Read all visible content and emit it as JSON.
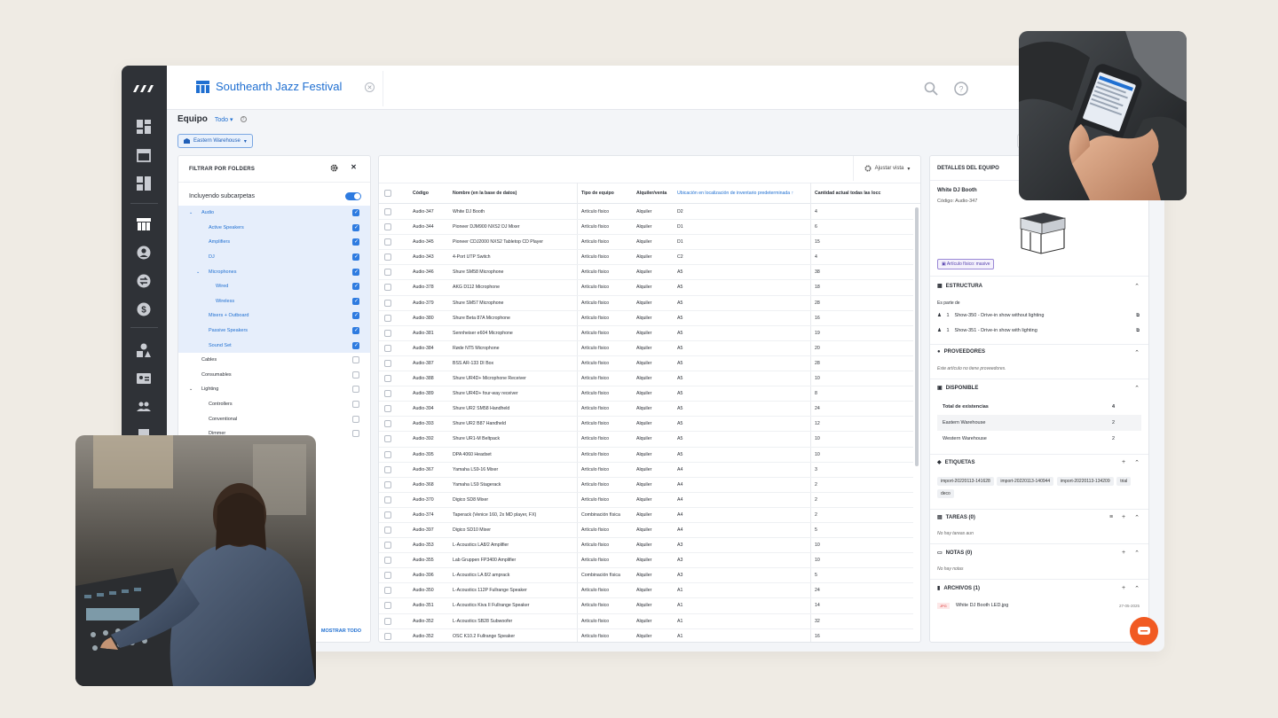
{
  "project": {
    "title": "Southearth Jazz Festival"
  },
  "notifications": {
    "count": "1"
  },
  "page": {
    "title": "Equipo",
    "scope": "Todo",
    "warehouse": "Eastern Warehouse"
  },
  "filter": {
    "title": "FILTRAR POR FOLDERS",
    "include_sub": "Incluyendo subcarpetas",
    "items": [
      {
        "label": "Audio",
        "checked": true
      },
      {
        "label": "Active Speakers",
        "checked": true
      },
      {
        "label": "Amplifiers",
        "checked": true
      },
      {
        "label": "DJ",
        "checked": true
      },
      {
        "label": "Microphones",
        "checked": true
      },
      {
        "label": "Wired",
        "checked": true
      },
      {
        "label": "Wireless",
        "checked": true
      },
      {
        "label": "Mixers + Outboard",
        "checked": true
      },
      {
        "label": "Passive Speakers",
        "checked": true
      },
      {
        "label": "Sound Set",
        "checked": true
      },
      {
        "label": "Cables",
        "checked": false
      },
      {
        "label": "Consumables",
        "checked": false
      },
      {
        "label": "Lighting",
        "checked": false
      },
      {
        "label": "Controllers",
        "checked": false
      },
      {
        "label": "Conventional",
        "checked": false
      },
      {
        "label": "Dimmer",
        "checked": false
      }
    ],
    "show_all": "MOSTRAR TODO"
  },
  "table": {
    "adjust_view": "Ajustar vista",
    "headers": {
      "code": "Código",
      "name": "Nombre (en la base de datos)",
      "type": "Tipo de equipo",
      "rent": "Alquiler/venta",
      "loc": "Ubicación en localización de inventario predeterminada",
      "qty": "Cantidad actual todas las locc"
    },
    "rows": [
      [
        "Audio-347",
        "White DJ Booth",
        "Artículo físico",
        "Alquiler",
        "D2",
        "4"
      ],
      [
        "Audio-344",
        "Pioneer DJM900 NXS2 DJ Mixer",
        "Artículo físico",
        "Alquiler",
        "D1",
        "6"
      ],
      [
        "Audio-345",
        "Pioneer CDJ2000 NXS2 Tabletop CD Player",
        "Artículo físico",
        "Alquiler",
        "D1",
        "15"
      ],
      [
        "Audio-343",
        "4-Port UTP Switch",
        "Artículo físico",
        "Alquiler",
        "C2",
        "4"
      ],
      [
        "Audio-346",
        "Shure SM58 Microphone",
        "Artículo físico",
        "Alquiler",
        "A5",
        "38"
      ],
      [
        "Audio-378",
        "AKG D112 Microphone",
        "Artículo físico",
        "Alquiler",
        "A5",
        "18"
      ],
      [
        "Audio-379",
        "Shure SM57 Microphone",
        "Artículo físico",
        "Alquiler",
        "A5",
        "28"
      ],
      [
        "Audio-380",
        "Shure Beta 87A Microphone",
        "Artículo físico",
        "Alquiler",
        "A5",
        "16"
      ],
      [
        "Audio-381",
        "Sennheiser e604 Microphone",
        "Artículo físico",
        "Alquiler",
        "A5",
        "19"
      ],
      [
        "Audio-384",
        "Røde NT5 Microphone",
        "Artículo físico",
        "Alquiler",
        "A5",
        "20"
      ],
      [
        "Audio-387",
        "BSS AR-133 DI Box",
        "Artículo físico",
        "Alquiler",
        "A5",
        "28"
      ],
      [
        "Audio-388",
        "Shure UR4D+ Microphone Receiver",
        "Artículo físico",
        "Alquiler",
        "A5",
        "10"
      ],
      [
        "Audio-389",
        "Shure UR4D+ four-way receiver",
        "Artículo físico",
        "Alquiler",
        "A5",
        "8"
      ],
      [
        "Audio-394",
        "Shure UR2 SM58 Handheld",
        "Artículo físico",
        "Alquiler",
        "A5",
        "24"
      ],
      [
        "Audio-393",
        "Shure UR2 B87 Handheld",
        "Artículo físico",
        "Alquiler",
        "A5",
        "12"
      ],
      [
        "Audio-392",
        "Shure UR1-M Beltpack",
        "Artículo físico",
        "Alquiler",
        "A5",
        "10"
      ],
      [
        "Audio-395",
        "DPA 4060 Headset",
        "Artículo físico",
        "Alquiler",
        "A5",
        "10"
      ],
      [
        "Audio-367",
        "Yamaha LS9-16 Mixer",
        "Artículo físico",
        "Alquiler",
        "A4",
        "3"
      ],
      [
        "Audio-368",
        "Yamaha LS9 Stagerack",
        "Artículo físico",
        "Alquiler",
        "A4",
        "2"
      ],
      [
        "Audio-370",
        "Digico SD8 Mixer",
        "Artículo físico",
        "Alquiler",
        "A4",
        "2"
      ],
      [
        "Audio-374",
        "Taperack (Venice 160, 2x MD player, FX)",
        "Combinación física",
        "Alquiler",
        "A4",
        "2"
      ],
      [
        "Audio-397",
        "Digico SD10 Mixer",
        "Artículo físico",
        "Alquiler",
        "A4",
        "5"
      ],
      [
        "Audio-353",
        "L-Acoustics LA8/2 Amplifier",
        "Artículo físico",
        "Alquiler",
        "A3",
        "10"
      ],
      [
        "Audio-355",
        "Lab Gruppen FP3400 Amplifier",
        "Artículo físico",
        "Alquiler",
        "A3",
        "10"
      ],
      [
        "Audio-396",
        "L-Acoustics LA 8/2 amprack",
        "Combinación física",
        "Alquiler",
        "A3",
        "5"
      ],
      [
        "Audio-350",
        "L-Acoustics 112P Fullrange Speaker",
        "Artículo físico",
        "Alquiler",
        "A1",
        "24"
      ],
      [
        "Audio-351",
        "L-Acoustics Kiva II Fullrange Speaker",
        "Artículo físico",
        "Alquiler",
        "A1",
        "14"
      ],
      [
        "Audio-352",
        "L-Acoustics SB28 Subwoofer",
        "Artículo físico",
        "Alquiler",
        "A1",
        "32"
      ],
      [
        "Audio-352",
        "OSC K10.2 Fullrange Speaker",
        "Artículo físico",
        "Alquiler",
        "A1",
        "16"
      ]
    ]
  },
  "details": {
    "title": "DETALLES DEL EQUIPO",
    "name": "White DJ Booth",
    "code": "Código: Audio-347",
    "type_tag": "Artículo físico: masive",
    "structure": {
      "title": "ESTRUCTURA",
      "part_of": "Es parte de",
      "items": [
        {
          "qty": "1",
          "label": "Show-350 - Drive-in show without lighting"
        },
        {
          "qty": "1",
          "label": "Show-351 - Drive-in show with lighting"
        }
      ]
    },
    "suppliers": {
      "title": "PROVEEDORES",
      "empty": "Este artículo no tiene proveedores."
    },
    "available": {
      "title": "DISPONIBLE",
      "rows": [
        {
          "label": "Total de existencias",
          "value": "4"
        },
        {
          "label": "Eastern Warehouse",
          "value": "2"
        },
        {
          "label": "Western Warehouse",
          "value": "2"
        }
      ]
    },
    "tags": {
      "title": "ETIQUETAS",
      "items": [
        "import-20220113-141628",
        "import-20220113-140944",
        "import-20220113-134209",
        "trial",
        "deco"
      ]
    },
    "tasks": {
      "title": "TAREAS (0)",
      "empty": "No hay tareas aun"
    },
    "notes": {
      "title": "NOTAS (0)",
      "empty": "No hay notas"
    },
    "files": {
      "title": "ARCHIVOS (1)",
      "ext": "JPG",
      "name": "White DJ Booth LED.jpg",
      "date": "27-05-2025"
    }
  },
  "colors": {
    "accent": "#1f6fd1",
    "rail": "#2f3237",
    "badge": "#e8425a",
    "fab": "#f15a22",
    "background": "#efebe4"
  }
}
